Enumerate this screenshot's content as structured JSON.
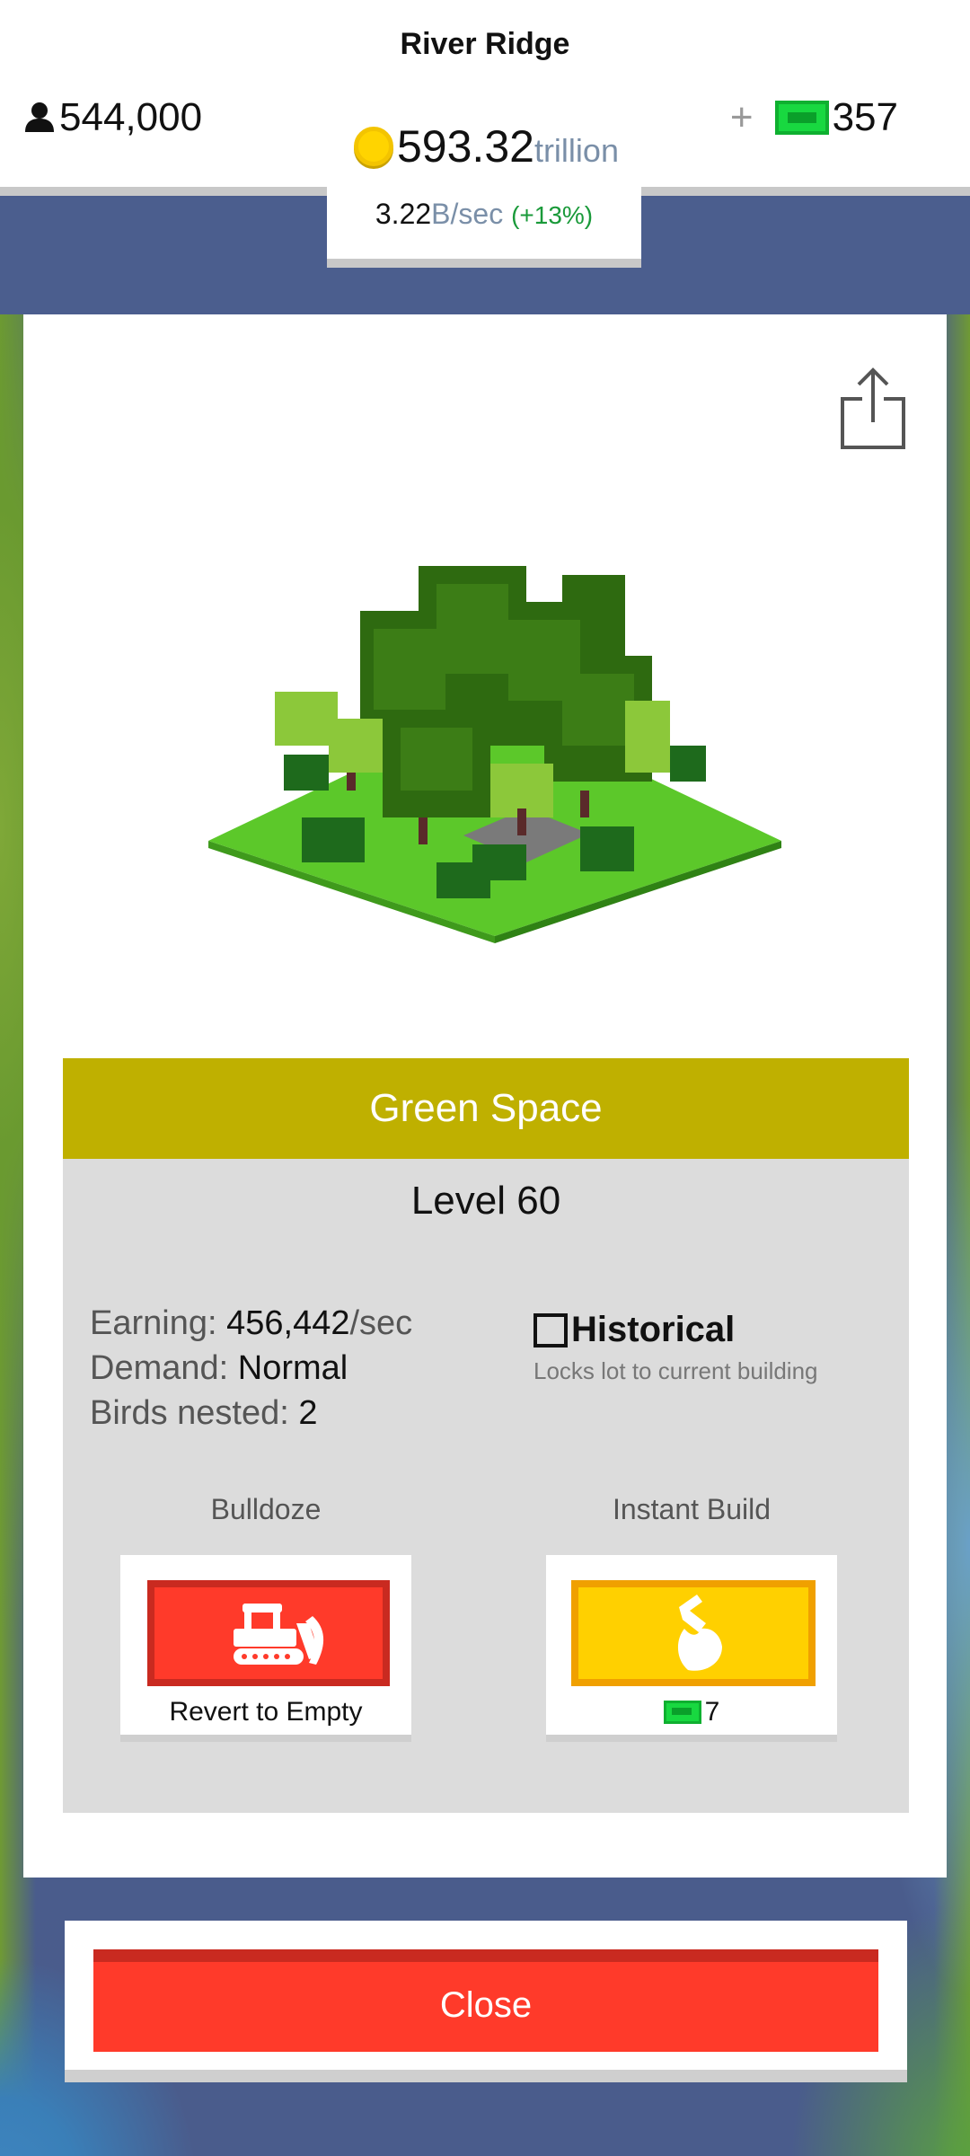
{
  "header": {
    "city_name": "River Ridge",
    "population": "544,000",
    "cash_value": "593.32",
    "cash_unit": "trillion",
    "bux": "357",
    "plus": "+",
    "rate_value": "3.22",
    "rate_unit": "B/sec",
    "rate_pct": "(+13%)"
  },
  "building": {
    "category": "Green Space",
    "level": "Level 60",
    "earning_label": "Earning:",
    "earning_value": "456,442",
    "earning_unit": "/sec",
    "demand_label": "Demand:",
    "demand_value": "Normal",
    "birds_label": "Birds nested:",
    "birds_value": "2"
  },
  "historical": {
    "title": "Historical",
    "description": "Locks lot to current building",
    "checked": false
  },
  "actions": {
    "bulldoze_label": "Bulldoze",
    "bulldoze_caption": "Revert to Empty",
    "instant_label": "Instant Build",
    "instant_cost": "7"
  },
  "close_label": "Close",
  "icons": [
    "person-icon",
    "coin-icon",
    "bux-icon",
    "share-icon",
    "bulldozer-icon",
    "hammer-icon"
  ],
  "colors": {
    "banner": "#bfb000",
    "red_button": "#ff3a2a",
    "orange_button": "#ffd000",
    "bux_green": "#18d840",
    "background_blue": "#4a5c8c"
  }
}
